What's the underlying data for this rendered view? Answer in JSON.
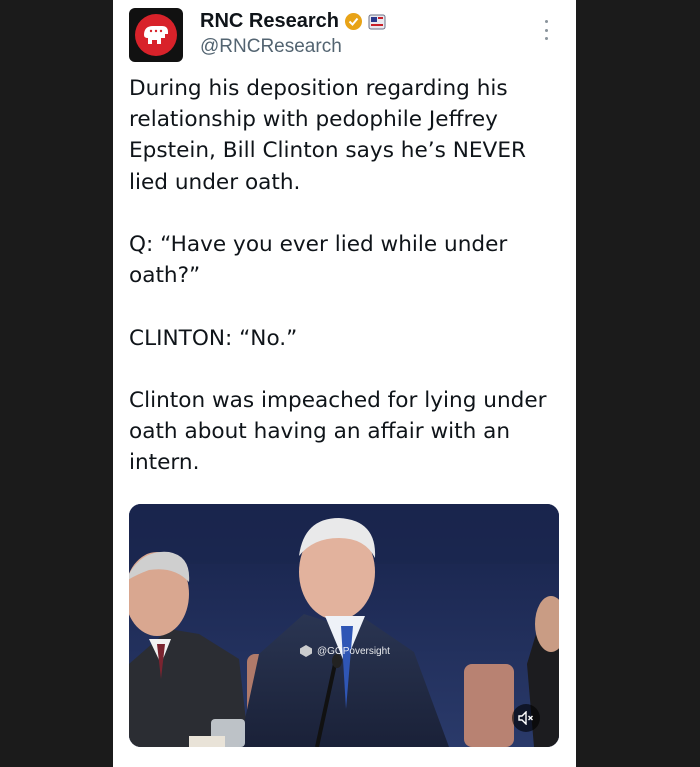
{
  "tweet": {
    "display_name": "RNC Research",
    "handle": "@RNCResearch",
    "paragraphs": [
      "During his deposition regarding his relationship with pedophile Jeffrey Epstein, Bill Clinton says he’s NEVER lied under oath.",
      "Q: “Have you ever lied while under oath?”",
      "CLINTON: “No.”",
      "Clinton was impeached for lying under oath about having an affair with an intern."
    ]
  },
  "media": {
    "watermark": "@GOPoversight"
  },
  "icons": {
    "avatar": "elephant-logo-icon",
    "verified": "verified-badge-icon",
    "flag": "flag-icon",
    "more": "more-options-icon",
    "mute": "muted-speaker-icon"
  },
  "colors": {
    "brand_red": "#d8222a",
    "verified_gold": "#e8a317",
    "handle_gray": "#536471",
    "text": "#0f1419"
  }
}
